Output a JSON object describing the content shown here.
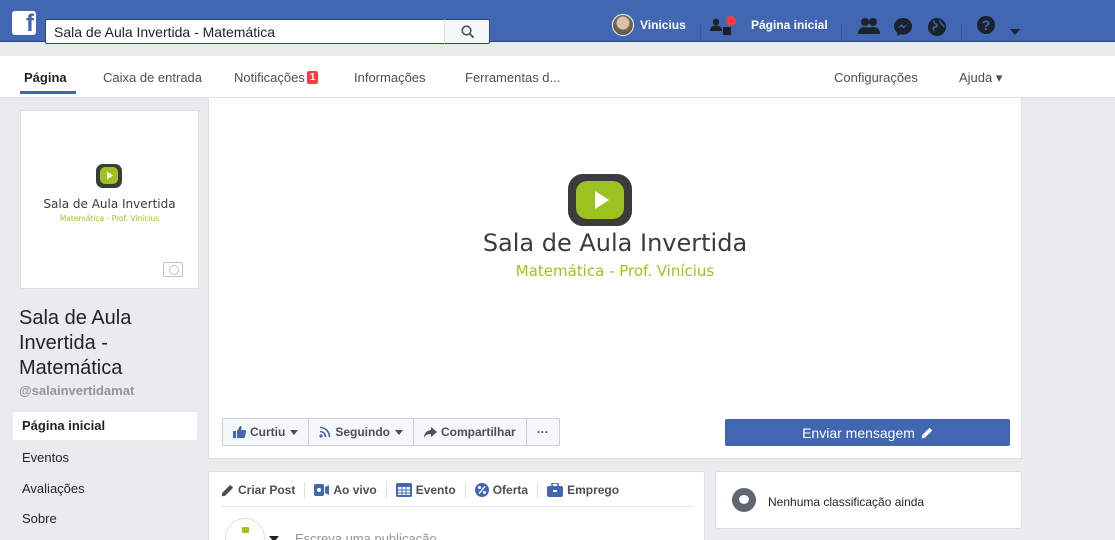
{
  "topbar": {
    "search_value": "Sala de Aula Invertida - Matemática",
    "user_name": "Vinicius",
    "home_label": "Página inicial"
  },
  "tabs": {
    "pagina": "Página",
    "caixa": "Caixa de entrada",
    "notificacoes": "Notificações",
    "notif_count": "1",
    "informacoes": "Informações",
    "ferramentas": "Ferramentas d...",
    "configuracoes": "Configurações",
    "ajuda": "Ajuda ▾"
  },
  "logo": {
    "title": "Sala de Aula Invertida",
    "subtitle": "Matemática - Prof. Vinícius",
    "accent_color": "#9cc31f"
  },
  "sidebar": {
    "page_name": "Sala de Aula Invertida - Matemática",
    "handle": "@salainvertidamat",
    "items": [
      {
        "label": "Página inicial"
      },
      {
        "label": "Eventos"
      },
      {
        "label": "Avaliações"
      },
      {
        "label": "Sobre"
      }
    ]
  },
  "actions": {
    "curtiu": "Curtiu",
    "seguindo": "Seguindo",
    "compartilhar": "Compartilhar",
    "more": "···",
    "message": "Enviar mensagem"
  },
  "composer": {
    "criar_post": "Criar Post",
    "ao_vivo": "Ao vivo",
    "evento": "Evento",
    "oferta": "Oferta",
    "emprego": "Emprego",
    "placeholder": "Escreva uma publicação..."
  },
  "rating": {
    "text": "Nenhuma classificação ainda"
  }
}
